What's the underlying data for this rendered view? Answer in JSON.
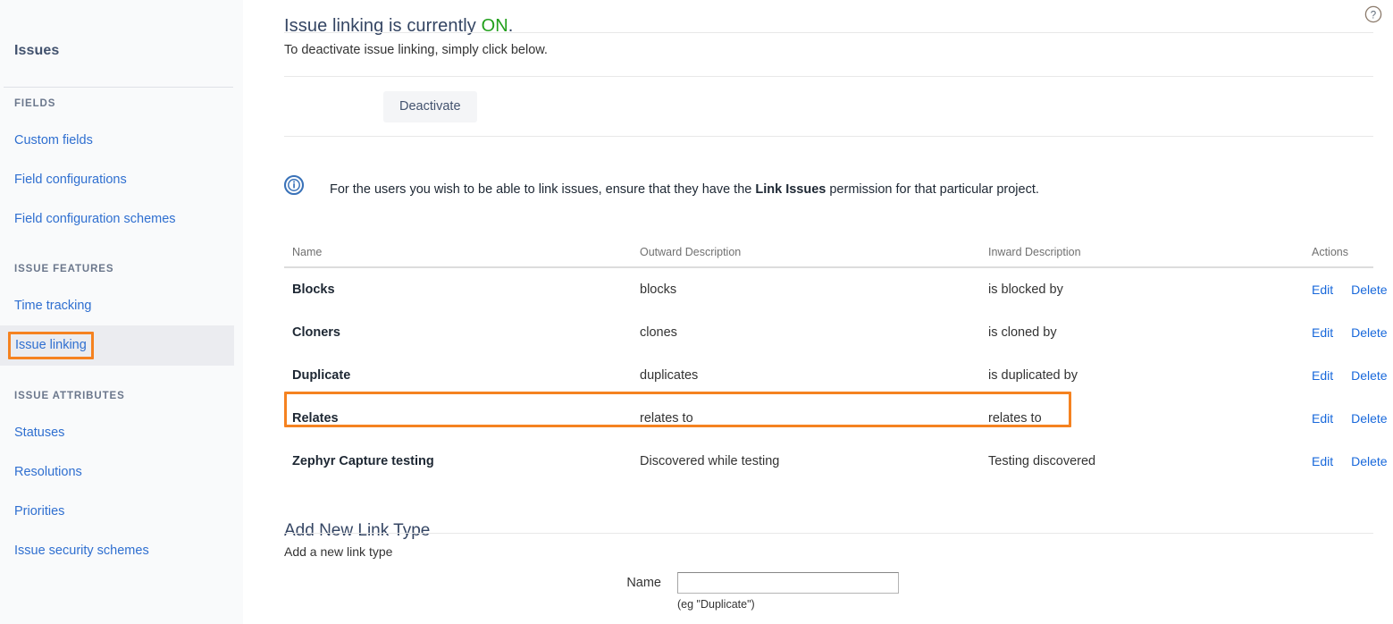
{
  "sidebar": {
    "title": "Issues",
    "groups": [
      {
        "heading": "FIELDS",
        "items": [
          {
            "label": "Custom fields"
          },
          {
            "label": "Field configurations"
          },
          {
            "label": "Field configuration schemes"
          }
        ]
      },
      {
        "heading": "ISSUE FEATURES",
        "items": [
          {
            "label": "Time tracking"
          },
          {
            "label": "Issue linking"
          }
        ]
      },
      {
        "heading": "ISSUE ATTRIBUTES",
        "items": [
          {
            "label": "Statuses"
          },
          {
            "label": "Resolutions"
          },
          {
            "label": "Priorities"
          },
          {
            "label": "Issue security schemes"
          }
        ]
      }
    ],
    "selected_item": "Issue linking",
    "annotation_color": "#f58220"
  },
  "header": {
    "title_prefix": "Issue linking is currently ",
    "status": "ON",
    "title_suffix": ".",
    "status_color": "#22a01c",
    "subtext": "To deactivate issue linking, simply click below.",
    "deactivate_label": "Deactivate",
    "help_icon": "question-mark-circle-icon"
  },
  "info": {
    "icon": "info-circle-icon",
    "text_before": "For the users you wish to be able to link issues, ensure that they have the ",
    "text_bold": "Link Issues",
    "text_after": " permission for that particular project."
  },
  "table": {
    "columns": [
      "Name",
      "Outward Description",
      "Inward Description",
      "Actions"
    ],
    "rows": [
      {
        "name": "Blocks",
        "outward": "blocks",
        "inward": "is blocked by",
        "edit": "Edit",
        "delete": "Delete",
        "highlighted": false
      },
      {
        "name": "Cloners",
        "outward": "clones",
        "inward": "is cloned by",
        "edit": "Edit",
        "delete": "Delete",
        "highlighted": false
      },
      {
        "name": "Duplicate",
        "outward": "duplicates",
        "inward": "is duplicated by",
        "edit": "Edit",
        "delete": "Delete",
        "highlighted": false
      },
      {
        "name": "Relates",
        "outward": "relates to",
        "inward": "relates to",
        "edit": "Edit",
        "delete": "Delete",
        "highlighted": true
      },
      {
        "name": "Zephyr Capture testing",
        "outward": "Discovered while testing",
        "inward": "Testing discovered",
        "edit": "Edit",
        "delete": "Delete",
        "highlighted": false
      }
    ]
  },
  "add_section": {
    "title": "Add New Link Type",
    "description": "Add a new link type",
    "name_label": "Name",
    "name_value": "",
    "name_placeholder": "",
    "name_hint": "(eg \"Duplicate\")"
  }
}
